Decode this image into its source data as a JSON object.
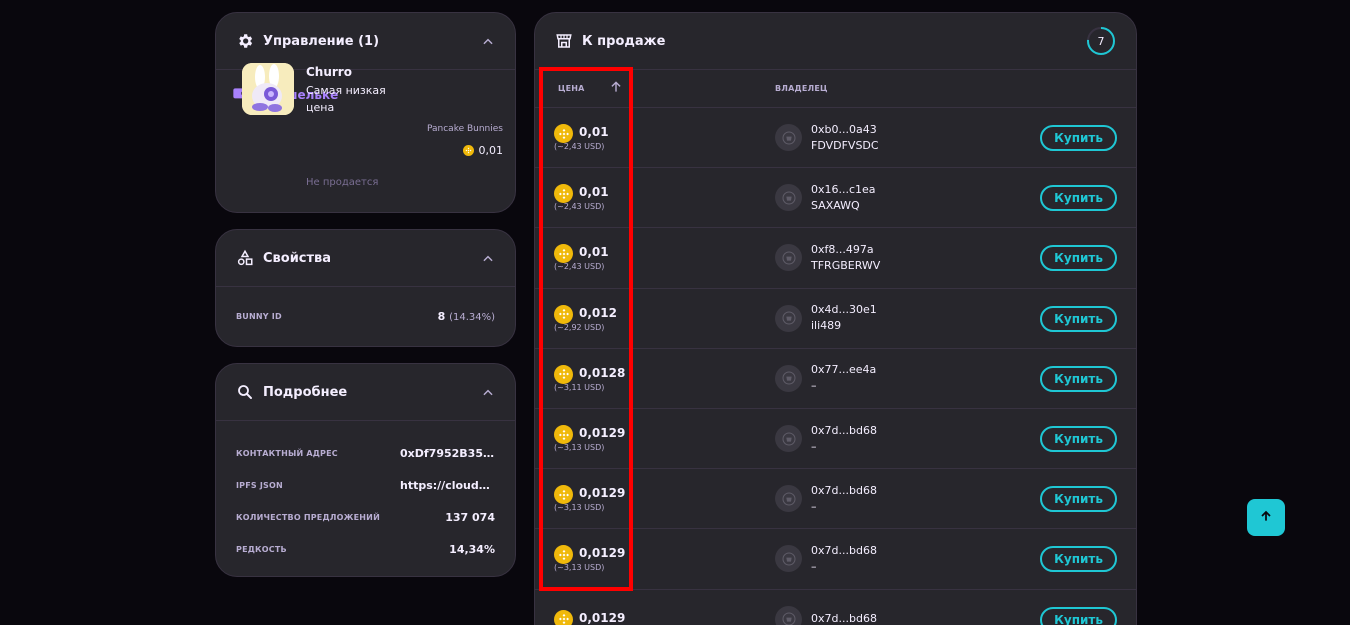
{
  "manage": {
    "title": "Управление (1)",
    "wallet_label": "В кошельке",
    "nft": {
      "name": "Churro",
      "subtitle": "Самая низкая цена",
      "status": "Не продается",
      "collection": "Pancake Bunnies",
      "price": "0,01"
    }
  },
  "properties": {
    "title": "Свойства",
    "rows": [
      {
        "label": "BUNNY ID",
        "value": "8",
        "extra": "(14.34%)"
      }
    ]
  },
  "details": {
    "title": "Подробнее",
    "rows": [
      {
        "label": "КОНТАКТНЫЙ АДРЕС",
        "value": "0xDf7952B35f..."
      },
      {
        "label": "IPFS JSON",
        "value": "https://cloudfl..."
      },
      {
        "label": "КОЛИЧЕСТВО ПРЕДЛОЖЕНИЙ",
        "value": "137 074"
      },
      {
        "label": "РЕДКОСТЬ",
        "value": "14,34%"
      }
    ]
  },
  "forsale": {
    "title": "К продаже",
    "refresh_countdown": "7",
    "col_price": "ЦЕНА",
    "col_owner": "ВЛАДЕЛЕЦ",
    "buy_label": "Купить",
    "rows": [
      {
        "price": "0,01",
        "usd": "(~2,43 USD)",
        "address": "0xb0...0a43",
        "name": "FDVDFVSDC"
      },
      {
        "price": "0,01",
        "usd": "(~2,43 USD)",
        "address": "0x16...c1ea",
        "name": "SAXAWQ"
      },
      {
        "price": "0,01",
        "usd": "(~2,43 USD)",
        "address": "0xf8...497a",
        "name": "TFRGBERWV"
      },
      {
        "price": "0,012",
        "usd": "(~2,92 USD)",
        "address": "0x4d...30e1",
        "name": "ili489"
      },
      {
        "price": "0,0128",
        "usd": "(~3,11 USD)",
        "address": "0x77...ee4a",
        "name": "–"
      },
      {
        "price": "0,0129",
        "usd": "(~3,13 USD)",
        "address": "0x7d...bd68",
        "name": "–"
      },
      {
        "price": "0,0129",
        "usd": "(~3,13 USD)",
        "address": "0x7d...bd68",
        "name": "–"
      },
      {
        "price": "0,0129",
        "usd": "(~3,13 USD)",
        "address": "0x7d...bd68",
        "name": "–"
      },
      {
        "price": "0,0129",
        "usd": "",
        "address": "0x7d...bd68",
        "name": ""
      }
    ]
  },
  "colors": {
    "accent": "#1fc7d4",
    "purple": "#a881fc",
    "card": "#27262c",
    "highlight": "#ff0000"
  }
}
